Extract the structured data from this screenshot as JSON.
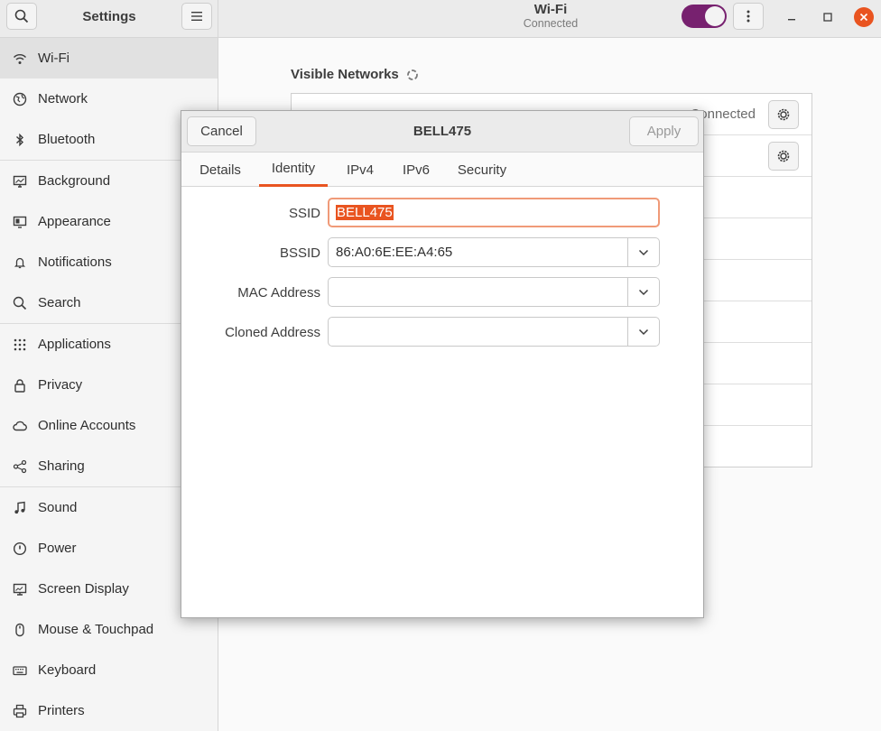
{
  "header": {
    "settings_title": "Settings",
    "page_title": "Wi-Fi",
    "page_subtitle": "Connected",
    "wifi_toggle_on": true
  },
  "sidebar": {
    "items": [
      {
        "label": "Wi-Fi",
        "icon": "wifi-icon"
      },
      {
        "label": "Network",
        "icon": "network-icon"
      },
      {
        "label": "Bluetooth",
        "icon": "bluetooth-icon"
      },
      {
        "label": "Background",
        "icon": "background-icon"
      },
      {
        "label": "Appearance",
        "icon": "appearance-icon"
      },
      {
        "label": "Notifications",
        "icon": "bell-icon"
      },
      {
        "label": "Search",
        "icon": "search-icon"
      },
      {
        "label": "Applications",
        "icon": "applications-icon"
      },
      {
        "label": "Privacy",
        "icon": "lock-icon"
      },
      {
        "label": "Online Accounts",
        "icon": "cloud-icon"
      },
      {
        "label": "Sharing",
        "icon": "share-icon"
      },
      {
        "label": "Sound",
        "icon": "music-note-icon"
      },
      {
        "label": "Power",
        "icon": "power-icon"
      },
      {
        "label": "Screen Display",
        "icon": "display-icon"
      },
      {
        "label": "Mouse & Touchpad",
        "icon": "mouse-icon"
      },
      {
        "label": "Keyboard",
        "icon": "keyboard-icon"
      },
      {
        "label": "Printers",
        "icon": "printer-icon"
      }
    ],
    "active_index": 0
  },
  "main": {
    "visible_networks_title": "Visible Networks",
    "connected_label": "Connected"
  },
  "dialog": {
    "title": "BELL475",
    "cancel_label": "Cancel",
    "apply_label": "Apply",
    "tabs": [
      "Details",
      "Identity",
      "IPv4",
      "IPv6",
      "Security"
    ],
    "active_tab": "Identity",
    "fields": {
      "ssid_label": "SSID",
      "ssid_value": "BELL475",
      "bssid_label": "BSSID",
      "bssid_value": "86:A0:6E:EE:A4:65",
      "mac_label": "MAC Address",
      "mac_value": "",
      "cloned_label": "Cloned Address",
      "cloned_value": ""
    }
  },
  "colors": {
    "accent": "#e95420",
    "toggle": "#77216f"
  }
}
